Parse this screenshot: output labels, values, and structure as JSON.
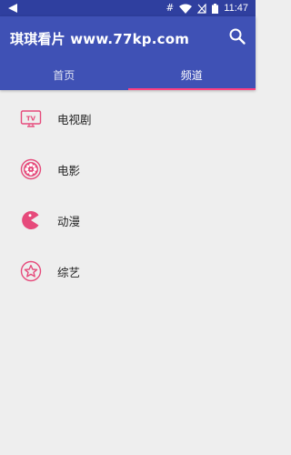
{
  "status_bar": {
    "time": "11:47",
    "hash_glyph": "#"
  },
  "app_bar": {
    "title": "琪琪看片 www.77kp.com",
    "search_icon": "search-icon"
  },
  "tabs": [
    {
      "label": "首页",
      "selected": false
    },
    {
      "label": "频道",
      "selected": true
    }
  ],
  "channels": [
    {
      "label": "电视剧",
      "icon": "tv-icon",
      "icon_text": "TV"
    },
    {
      "label": "电影",
      "icon": "film-reel-icon"
    },
    {
      "label": "动漫",
      "icon": "pacman-icon"
    },
    {
      "label": "综艺",
      "icon": "star-icon"
    }
  ],
  "colors": {
    "status_bar": "#2f3f9f",
    "app_bar": "#3f51b5",
    "accent": "#ff4081",
    "icon_pink": "#e64a7b",
    "background": "#eeeeee"
  }
}
